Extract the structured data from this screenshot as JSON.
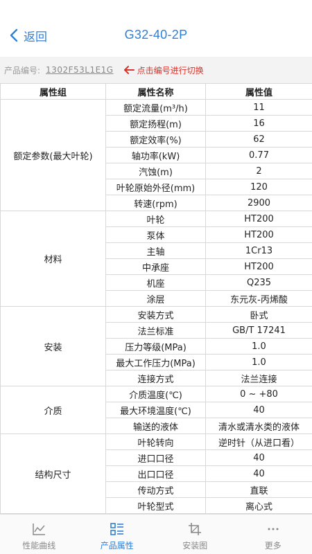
{
  "header": {
    "back_label": "返回",
    "title": "G32-40-2P"
  },
  "code_bar": {
    "label": "产品编号:",
    "value": "1302F53L1E1G",
    "hint": "点击编号进行切换"
  },
  "table": {
    "headers": [
      "属性组",
      "属性名称",
      "属性值"
    ],
    "groups": [
      {
        "name": "额定参数(最大叶轮)",
        "rows": [
          [
            "额定流量(m³/h)",
            "11"
          ],
          [
            "额定扬程(m)",
            "16"
          ],
          [
            "额定效率(%)",
            "62"
          ],
          [
            "轴功率(kW)",
            "0.77"
          ],
          [
            "汽蚀(m)",
            "2"
          ],
          [
            "叶轮原始外径(mm)",
            "120"
          ],
          [
            "转速(rpm)",
            "2900"
          ]
        ]
      },
      {
        "name": "材料",
        "rows": [
          [
            "叶轮",
            "HT200"
          ],
          [
            "泵体",
            "HT200"
          ],
          [
            "主轴",
            "1Cr13"
          ],
          [
            "中承座",
            "HT200"
          ],
          [
            "机座",
            "Q235"
          ],
          [
            "涂层",
            "东元灰-丙烯酸"
          ]
        ]
      },
      {
        "name": "安装",
        "rows": [
          [
            "安装方式",
            "卧式"
          ],
          [
            "法兰标准",
            "GB/T 17241"
          ],
          [
            "压力等级(MPa)",
            "1.0"
          ],
          [
            "最大工作压力(MPa)",
            "1.0"
          ],
          [
            "连接方式",
            "法兰连接"
          ]
        ]
      },
      {
        "name": "介质",
        "rows": [
          [
            "介质温度(℃)",
            "0 ~ +80"
          ],
          [
            "最大环境温度(℃)",
            "40"
          ],
          [
            "输送的液体",
            "清水或清水类的液体"
          ]
        ]
      },
      {
        "name": "结构尺寸",
        "rows": [
          [
            "叶轮转向",
            "逆时针（从进口看）"
          ],
          [
            "进口口径",
            "40"
          ],
          [
            "出口口径",
            "40"
          ],
          [
            "传动方式",
            "直联"
          ],
          [
            "叶轮型式",
            "离心式"
          ]
        ]
      }
    ]
  },
  "tabbar": {
    "tabs": [
      {
        "label": "性能曲线",
        "icon": "chart-line-icon",
        "active": false
      },
      {
        "label": "产品属性",
        "icon": "list-icon",
        "active": true
      },
      {
        "label": "安装图",
        "icon": "crop-icon",
        "active": false
      },
      {
        "label": "更多",
        "icon": "more-dots-icon",
        "active": false
      }
    ]
  },
  "colors": {
    "accent": "#2f7fd8",
    "hint_red": "#d9332b",
    "inactive": "#888888"
  }
}
